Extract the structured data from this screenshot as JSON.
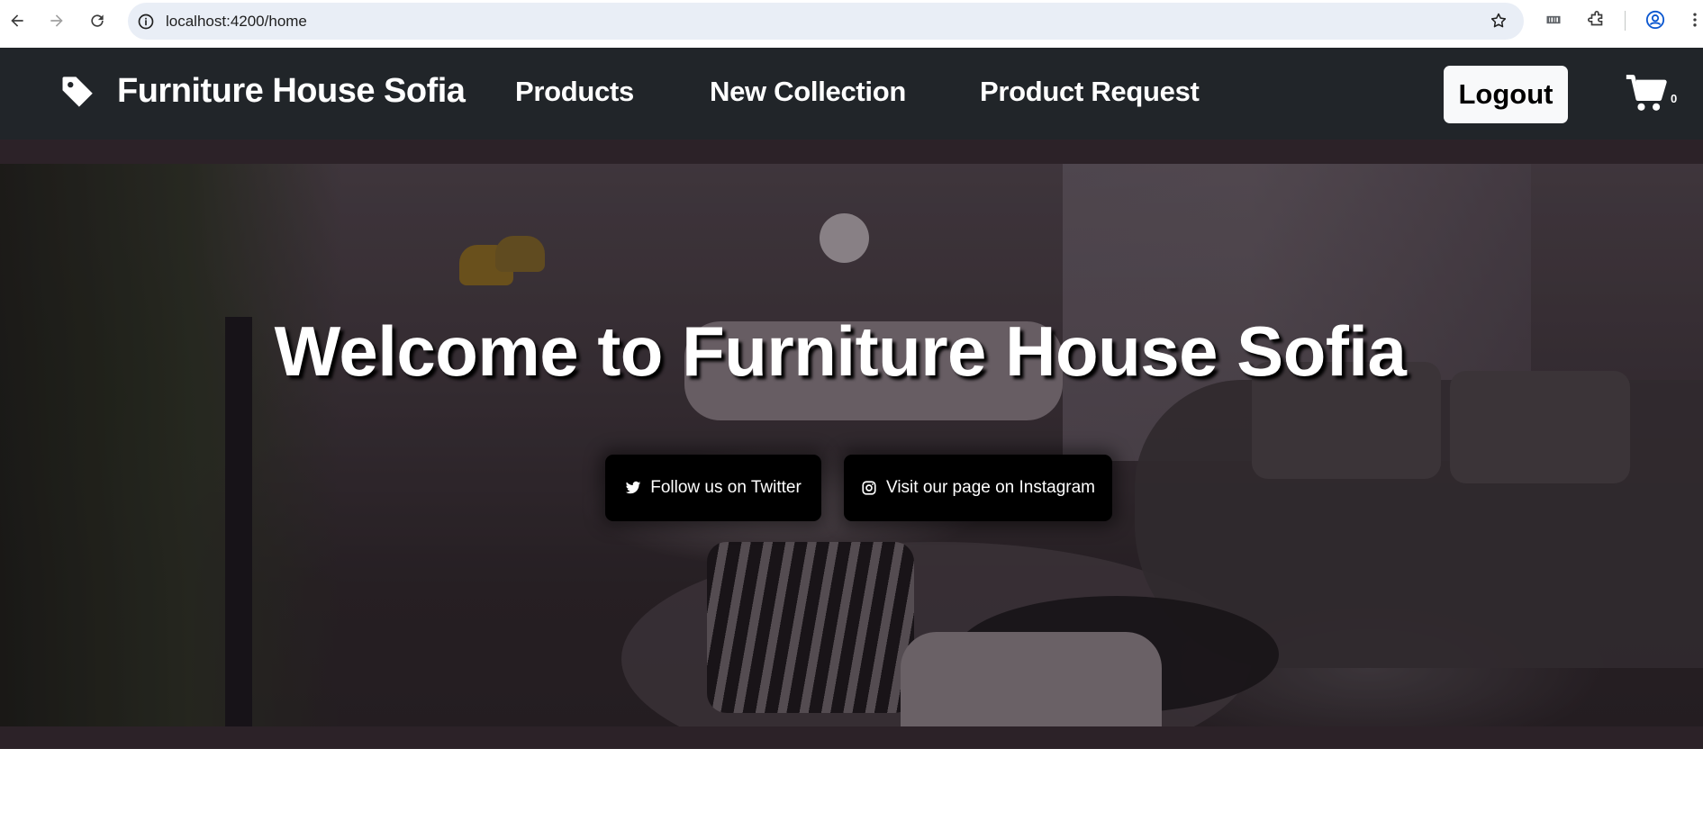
{
  "browser": {
    "url": "localhost:4200/home"
  },
  "navbar": {
    "brand": "Furniture House Sofia",
    "links": [
      {
        "label": "Products"
      },
      {
        "label": "New Collection"
      },
      {
        "label": "Product Request"
      }
    ],
    "logout_label": "Logout",
    "cart_count": "0"
  },
  "hero": {
    "title": "Welcome to Furniture House Sofia",
    "buttons": [
      {
        "label": "Follow us on Twitter",
        "icon": "twitter-icon"
      },
      {
        "label": "Visit our page on Instagram",
        "icon": "instagram-icon"
      }
    ]
  },
  "colors": {
    "navbar_bg": "#212529",
    "hero_band": "#2c2228",
    "button_bg": "#000000",
    "logout_bg": "#f8f9fa"
  }
}
